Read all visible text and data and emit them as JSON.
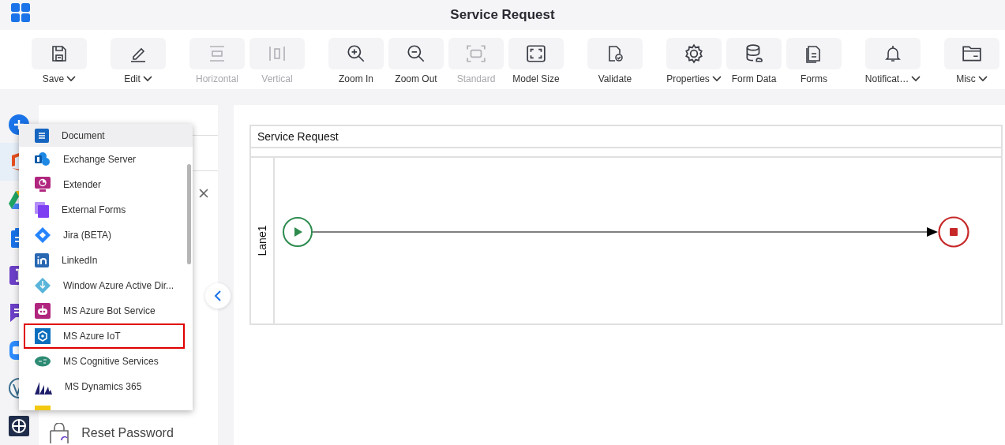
{
  "header": {
    "title": "Service Request"
  },
  "toolbar": [
    [
      {
        "label": "Save",
        "kind": "save",
        "dropdown": true,
        "disabled": false
      }
    ],
    [
      {
        "label": "Edit",
        "kind": "edit",
        "dropdown": true,
        "disabled": false
      }
    ],
    [
      {
        "label": "Horizontal",
        "kind": "horizontal",
        "dropdown": false,
        "disabled": true
      },
      {
        "label": "Vertical",
        "kind": "vertical",
        "dropdown": false,
        "disabled": true
      }
    ],
    [
      {
        "label": "Zoom In",
        "kind": "zoomin",
        "dropdown": false,
        "disabled": false
      },
      {
        "label": "Zoom Out",
        "kind": "zoomout",
        "dropdown": false,
        "disabled": false
      },
      {
        "label": "Standard",
        "kind": "standard",
        "dropdown": false,
        "disabled": true
      },
      {
        "label": "Model Size",
        "kind": "modelsize",
        "dropdown": false,
        "disabled": false
      }
    ],
    [
      {
        "label": "Validate",
        "kind": "validate",
        "dropdown": false,
        "disabled": false
      }
    ],
    [
      {
        "label": "Properties",
        "kind": "properties",
        "dropdown": true,
        "disabled": false
      },
      {
        "label": "Form Data",
        "kind": "formdata",
        "dropdown": false,
        "disabled": false
      },
      {
        "label": "Forms",
        "kind": "forms",
        "dropdown": false,
        "disabled": false
      }
    ],
    [
      {
        "label": "Notificat…",
        "kind": "notifications",
        "dropdown": true,
        "disabled": false
      }
    ],
    [
      {
        "label": "Misc",
        "kind": "misc",
        "dropdown": true,
        "disabled": false
      }
    ]
  ],
  "rail": [
    {
      "kind": "plus",
      "selected": false
    },
    {
      "kind": "office",
      "selected": true
    },
    {
      "kind": "drive",
      "selected": false
    },
    {
      "kind": "clipboard",
      "selected": false
    },
    {
      "kind": "letter",
      "selected": false
    },
    {
      "kind": "chat",
      "selected": false
    },
    {
      "kind": "video",
      "selected": false
    },
    {
      "kind": "wordpress",
      "selected": false
    },
    {
      "kind": "grid",
      "selected": false
    }
  ],
  "library": {
    "reset_item": "Reset Password"
  },
  "dropdown": [
    {
      "label": "Document",
      "kind": "document",
      "color": "#1565c0",
      "selected": true,
      "highlighted": false
    },
    {
      "label": "Exchange Server",
      "kind": "exchange",
      "color": "#1e88e5",
      "selected": false,
      "highlighted": false
    },
    {
      "label": "Extender",
      "kind": "extender",
      "color": "#b0257e",
      "selected": false,
      "highlighted": false
    },
    {
      "label": "External Forms",
      "kind": "forms",
      "color": "#7e3ff2",
      "selected": false,
      "highlighted": false
    },
    {
      "label": "Jira (BETA)",
      "kind": "jira",
      "color": "#2684ff",
      "selected": false,
      "highlighted": false
    },
    {
      "label": "LinkedIn",
      "kind": "linkedin",
      "color": "#2867b2",
      "selected": false,
      "highlighted": false
    },
    {
      "label": "Window Azure Active Dir...",
      "kind": "azuread",
      "color": "#59b4d9",
      "selected": false,
      "highlighted": false
    },
    {
      "label": "MS Azure Bot Service",
      "kind": "bot",
      "color": "#b0257e",
      "selected": false,
      "highlighted": false
    },
    {
      "label": "MS Azure IoT",
      "kind": "iot",
      "color": "#0a6ebd",
      "selected": false,
      "highlighted": true
    },
    {
      "label": "MS Cognitive Services",
      "kind": "cognitive",
      "color": "#2e8b74",
      "selected": false,
      "highlighted": false
    },
    {
      "label": "MS Dynamics 365",
      "kind": "dynamics",
      "color": "#1f1f6b",
      "selected": false,
      "highlighted": false
    }
  ],
  "diagram": {
    "pool": "Service Request",
    "lane": "Lane1"
  }
}
